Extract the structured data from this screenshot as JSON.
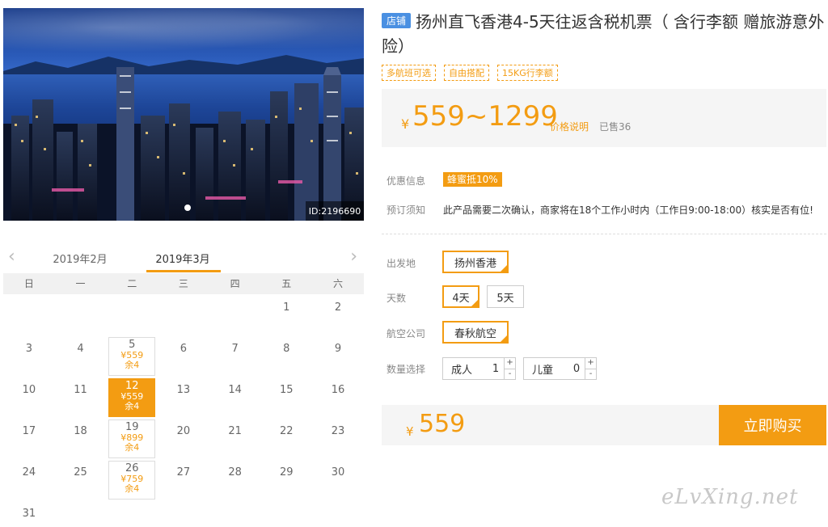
{
  "hero": {
    "id_label": "ID:2196690"
  },
  "calendar": {
    "prev_month": "2019年2月",
    "current_month": "2019年3月",
    "weekdays": [
      "日",
      "一",
      "二",
      "三",
      "四",
      "五",
      "六"
    ],
    "weeks": [
      [
        {
          "d": ""
        },
        {
          "d": ""
        },
        {
          "d": ""
        },
        {
          "d": ""
        },
        {
          "d": ""
        },
        {
          "d": "1"
        },
        {
          "d": "2"
        }
      ],
      [
        {
          "d": "3"
        },
        {
          "d": "4"
        },
        {
          "d": "5",
          "price": "¥559",
          "remain": "余4"
        },
        {
          "d": "6"
        },
        {
          "d": "7"
        },
        {
          "d": "8"
        },
        {
          "d": "9"
        }
      ],
      [
        {
          "d": "10"
        },
        {
          "d": "11"
        },
        {
          "d": "12",
          "price": "¥559",
          "remain": "余4",
          "selected": true
        },
        {
          "d": "13"
        },
        {
          "d": "14"
        },
        {
          "d": "15"
        },
        {
          "d": "16"
        }
      ],
      [
        {
          "d": "17"
        },
        {
          "d": "18"
        },
        {
          "d": "19",
          "price": "¥899",
          "remain": "余4"
        },
        {
          "d": "20"
        },
        {
          "d": "21"
        },
        {
          "d": "22"
        },
        {
          "d": "23"
        }
      ],
      [
        {
          "d": "24"
        },
        {
          "d": "25"
        },
        {
          "d": "26",
          "price": "¥759",
          "remain": "余4"
        },
        {
          "d": "27"
        },
        {
          "d": "28"
        },
        {
          "d": "29"
        },
        {
          "d": "30"
        }
      ],
      [
        {
          "d": "31"
        },
        {
          "d": ""
        },
        {
          "d": ""
        },
        {
          "d": ""
        },
        {
          "d": ""
        },
        {
          "d": ""
        },
        {
          "d": ""
        }
      ]
    ]
  },
  "product": {
    "shop_badge": "店铺",
    "title": "扬州直飞香港4-5天往返含税机票（ 含行李额 赠旅游意外险）",
    "tags": [
      "多航班可选",
      "自由搭配",
      "15KG行李额"
    ],
    "currency": "¥",
    "price_range": "559~1299",
    "price_note": "价格说明",
    "sold": "已售36"
  },
  "info": {
    "promo_label": "优惠信息",
    "promo_value": "蜂蜜抵10%",
    "notice_label": "预订须知",
    "notice_value": "此产品需要二次确认，商家将在18个工作小时内（工作日9:00-18:00）核实是否有位!"
  },
  "options": {
    "departure_label": "出发地",
    "departure_options": [
      "扬州香港"
    ],
    "days_label": "天数",
    "days_options": [
      "4天",
      "5天"
    ],
    "airline_label": "航空公司",
    "airline_options": [
      "春秋航空"
    ],
    "qty_label": "数量选择",
    "adult_label": "成人",
    "adult_count": "1",
    "child_label": "儿童",
    "child_count": "0",
    "plus": "+",
    "minus": "-"
  },
  "purchase": {
    "currency": "¥",
    "total": "559",
    "buy_label": "立即购买"
  },
  "watermark": "eLvXing.net"
}
